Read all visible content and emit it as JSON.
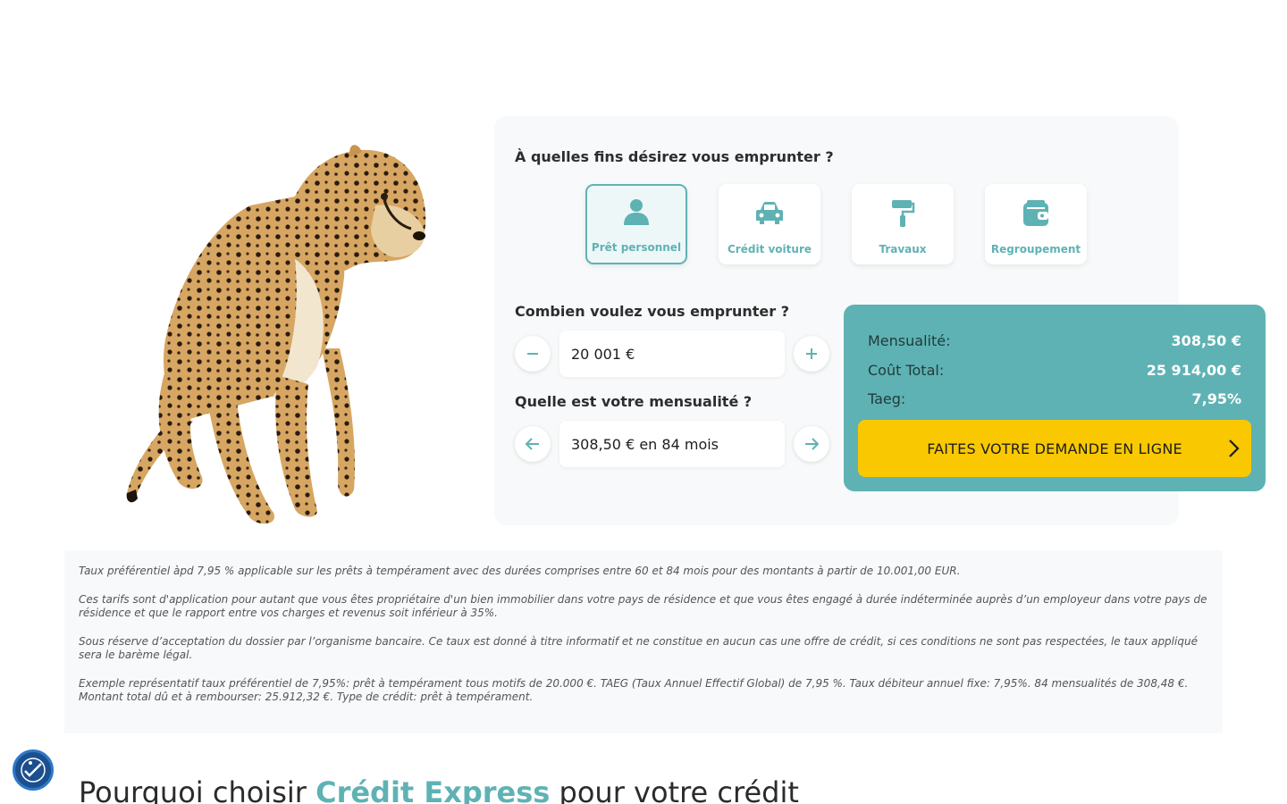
{
  "simulator": {
    "purpose_question": "À quelles fins désirez vous emprunter ?",
    "purposes": [
      {
        "label": "Prêt personnel",
        "icon": "person-icon",
        "selected": true
      },
      {
        "label": "Crédit voiture",
        "icon": "car-icon",
        "selected": false
      },
      {
        "label": "Travaux",
        "icon": "paint-roller-icon",
        "selected": false
      },
      {
        "label": "Regroupement",
        "icon": "wallet-icon",
        "selected": false
      }
    ],
    "amount_question": "Combien voulez vous emprunter ?",
    "amount_value": "20 001 €",
    "monthly_question": "Quelle est votre mensualité ?",
    "monthly_value": "308,50 € en 84 mois"
  },
  "result": {
    "rows": [
      {
        "label": "Mensualité:",
        "value": "308,50 €"
      },
      {
        "label": "Coût Total:",
        "value": "25 914,00 €"
      },
      {
        "label": "Taeg:",
        "value": "7,95%"
      }
    ],
    "cta_label": "FAITES VOTRE DEMANDE EN LIGNE"
  },
  "legal": [
    "Taux préférentiel àpd 7,95 % applicable sur les prêts à tempérament avec des durées comprises entre 60 et 84 mois pour des montants à partir de 10.001,00 EUR.",
    "Ces tarifs sont d'application pour autant que vous êtes propriétaire d'un bien immobilier dans votre pays de résidence et que vous êtes engagé à durée indéterminée auprès d’un employeur dans votre pays de résidence et que le rapport entre vos charges et revenus soit inférieur à 35%.",
    "Sous réserve d’acceptation du dossier par l’organisme bancaire. Ce taux est donné à titre informatif et ne constitue en aucun cas une offre de crédit, si ces conditions ne sont pas respectées, le taux appliqué sera le barème légal.",
    "Exemple représentatif taux préférentiel de 7,95%: prêt à tempérament tous motifs de 20.000 €. TAEG (Taux Annuel Effectif Global) de 7,95 %. Taux débiteur annuel fixe: 7,95%. 84 mensualités de 308,48 €. Montant total dû et à rembourser: 25.912,32 €. Type de crédit: prêt à tempérament."
  ],
  "why": {
    "prefix": "Pourquoi choisir ",
    "brand": "Crédit Express",
    "suffix": " pour votre crédit"
  },
  "colors": {
    "accent": "#5fb2b4",
    "cta": "#f9c800",
    "card_bg": "#f7f9fa"
  }
}
